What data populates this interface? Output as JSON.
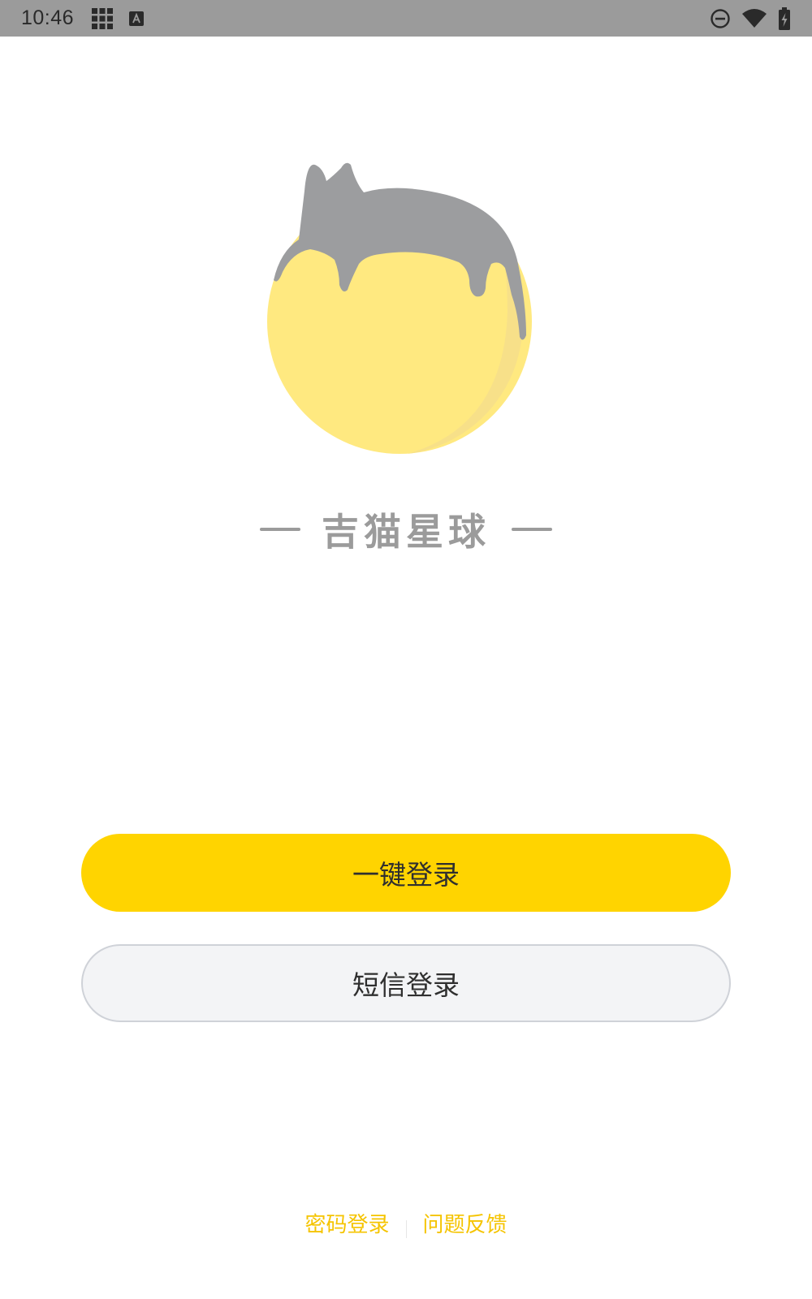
{
  "status_bar": {
    "time": "10:46",
    "icons": [
      "grid-icon",
      "keyboard-a-icon",
      "do-not-disturb-icon",
      "wifi-icon",
      "battery-charging-icon"
    ]
  },
  "brand": {
    "name": "吉猫星球"
  },
  "buttons": {
    "one_click_login": "一键登录",
    "sms_login": "短信登录"
  },
  "links": {
    "password_login": "密码登录",
    "feedback": "问题反馈"
  },
  "colors": {
    "accent": "#ffd400",
    "link": "#f5c400",
    "status_bar": "#9b9b9b",
    "logo_circle": "#ffe980",
    "logo_cat": "#9c9d9f",
    "secondary_button_bg": "#f3f4f6",
    "secondary_button_border": "#cfd2d8"
  }
}
